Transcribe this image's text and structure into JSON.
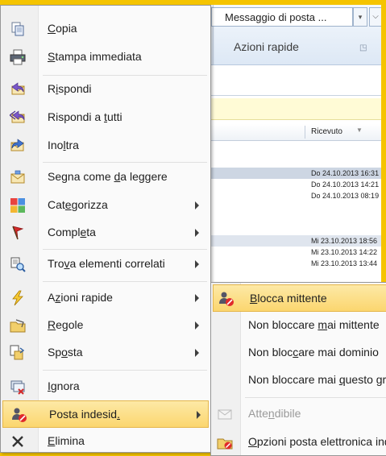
{
  "ribbon": {
    "quicksteps_box": "Messaggio di posta ...",
    "quicksteps_label": "Azioni rapide"
  },
  "message_list": {
    "column_received": "Ricevuto",
    "rows": [
      "Do 24.10.2013 16:31",
      "Do 24.10.2013 14:21",
      "Do 24.10.2013 08:19",
      "Mi 23.10.2013 18:56",
      "Mi 23.10.2013 14:22",
      "Mi 23.10.2013 13:44"
    ]
  },
  "menu": {
    "copy": {
      "pre": "",
      "key": "C",
      "post": "opia"
    },
    "quick_print": {
      "pre": "",
      "key": "S",
      "post": "tampa immediata"
    },
    "reply": {
      "pre": "R",
      "key": "i",
      "post": "spondi"
    },
    "reply_all": {
      "pre": "Rispondi a ",
      "key": "t",
      "post": "utti"
    },
    "forward": {
      "pre": "Ino",
      "key": "l",
      "post": "tra"
    },
    "mark_read": {
      "pre": "Segna come ",
      "key": "d",
      "post": "a leggere"
    },
    "categorize": {
      "pre": "Cat",
      "key": "e",
      "post": "gorizza"
    },
    "followup": {
      "pre": "Compl",
      "key": "e",
      "post": "ta"
    },
    "find_related": {
      "pre": "Tro",
      "key": "v",
      "post": "a elementi correlati"
    },
    "quick_steps": {
      "pre": "A",
      "key": "z",
      "post": "ioni rapide"
    },
    "rules": {
      "pre": "",
      "key": "R",
      "post": "egole"
    },
    "move": {
      "pre": "Sp",
      "key": "o",
      "post": "sta"
    },
    "ignore": {
      "pre": "",
      "key": "I",
      "post": "gnora"
    },
    "junk": {
      "pre": "Posta indesid",
      "key": ".",
      "post": ""
    },
    "delete": {
      "pre": "",
      "key": "E",
      "post": "limina"
    }
  },
  "submenu": {
    "block_sender": {
      "pre": "",
      "key": "B",
      "post": "locca mittente"
    },
    "never_block_sender": {
      "pre": "Non bloccare ",
      "key": "m",
      "post": "ai mittente"
    },
    "never_block_domain": {
      "pre": "Non bloc",
      "key": "c",
      "post": "are mai dominio"
    },
    "never_block_group": {
      "pre": "Non bloccare mai ",
      "key": "q",
      "post": "uesto gruppo"
    },
    "not_junk": {
      "pre": "Atte",
      "key": "n",
      "post": "dibile"
    },
    "junk_options": {
      "pre": "",
      "key": "O",
      "post": "pzioni posta elettronica indesiderata"
    }
  },
  "colors": {
    "frame": "#f5c400",
    "highlight": "#fbd66f",
    "menu_bg": "#fafafa"
  }
}
